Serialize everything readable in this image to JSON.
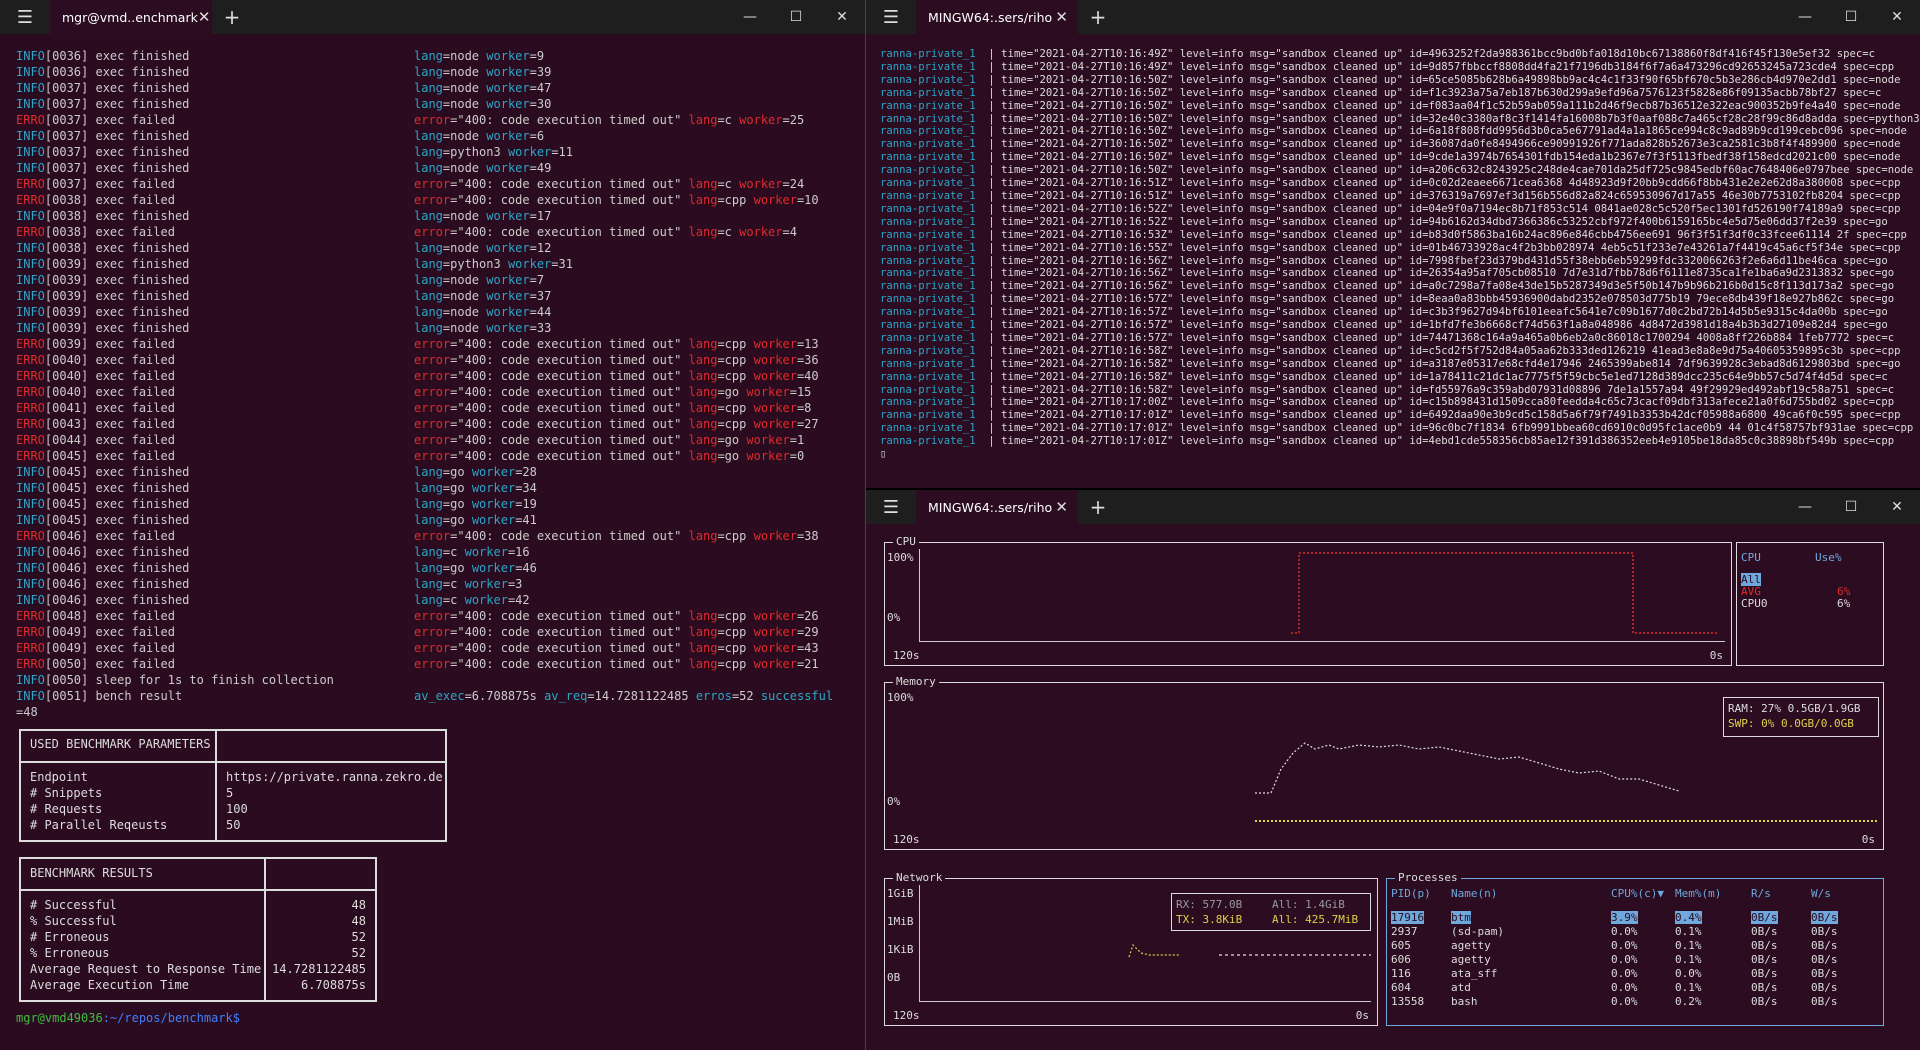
{
  "left": {
    "tab": "mgr@vmd..enchmark",
    "lines": [
      [
        "INFO",
        "[0036] exec finished",
        [
          [
            "lang",
            "node"
          ],
          [
            "worker",
            "9"
          ]
        ]
      ],
      [
        "INFO",
        "[0036] exec finished",
        [
          [
            "lang",
            "node"
          ],
          [
            "worker",
            "39"
          ]
        ]
      ],
      [
        "INFO",
        "[0037] exec finished",
        [
          [
            "lang",
            "node"
          ],
          [
            "worker",
            "47"
          ]
        ]
      ],
      [
        "INFO",
        "[0037] exec finished",
        [
          [
            "lang",
            "node"
          ],
          [
            "worker",
            "30"
          ]
        ]
      ],
      [
        "ERRO",
        "[0037] exec failed",
        [
          [
            "error",
            "\"400: code execution timed out\""
          ],
          [
            "lang",
            "c"
          ],
          [
            "worker",
            "25"
          ]
        ]
      ],
      [
        "INFO",
        "[0037] exec finished",
        [
          [
            "lang",
            "node"
          ],
          [
            "worker",
            "6"
          ]
        ]
      ],
      [
        "INFO",
        "[0037] exec finished",
        [
          [
            "lang",
            "python3"
          ],
          [
            "worker",
            "11"
          ]
        ]
      ],
      [
        "INFO",
        "[0037] exec finished",
        [
          [
            "lang",
            "node"
          ],
          [
            "worker",
            "49"
          ]
        ]
      ],
      [
        "ERRO",
        "[0037] exec failed",
        [
          [
            "error",
            "\"400: code execution timed out\""
          ],
          [
            "lang",
            "c"
          ],
          [
            "worker",
            "24"
          ]
        ]
      ],
      [
        "ERRO",
        "[0038] exec failed",
        [
          [
            "error",
            "\"400: code execution timed out\""
          ],
          [
            "lang",
            "cpp"
          ],
          [
            "worker",
            "10"
          ]
        ]
      ],
      [
        "INFO",
        "[0038] exec finished",
        [
          [
            "lang",
            "node"
          ],
          [
            "worker",
            "17"
          ]
        ]
      ],
      [
        "ERRO",
        "[0038] exec failed",
        [
          [
            "error",
            "\"400: code execution timed out\""
          ],
          [
            "lang",
            "c"
          ],
          [
            "worker",
            "4"
          ]
        ]
      ],
      [
        "INFO",
        "[0038] exec finished",
        [
          [
            "lang",
            "node"
          ],
          [
            "worker",
            "12"
          ]
        ]
      ],
      [
        "INFO",
        "[0039] exec finished",
        [
          [
            "lang",
            "python3"
          ],
          [
            "worker",
            "31"
          ]
        ]
      ],
      [
        "INFO",
        "[0039] exec finished",
        [
          [
            "lang",
            "node"
          ],
          [
            "worker",
            "7"
          ]
        ]
      ],
      [
        "INFO",
        "[0039] exec finished",
        [
          [
            "lang",
            "node"
          ],
          [
            "worker",
            "37"
          ]
        ]
      ],
      [
        "INFO",
        "[0039] exec finished",
        [
          [
            "lang",
            "node"
          ],
          [
            "worker",
            "44"
          ]
        ]
      ],
      [
        "INFO",
        "[0039] exec finished",
        [
          [
            "lang",
            "node"
          ],
          [
            "worker",
            "33"
          ]
        ]
      ],
      [
        "ERRO",
        "[0039] exec failed",
        [
          [
            "error",
            "\"400: code execution timed out\""
          ],
          [
            "lang",
            "cpp"
          ],
          [
            "worker",
            "13"
          ]
        ]
      ],
      [
        "ERRO",
        "[0040] exec failed",
        [
          [
            "error",
            "\"400: code execution timed out\""
          ],
          [
            "lang",
            "cpp"
          ],
          [
            "worker",
            "36"
          ]
        ]
      ],
      [
        "ERRO",
        "[0040] exec failed",
        [
          [
            "error",
            "\"400: code execution timed out\""
          ],
          [
            "lang",
            "cpp"
          ],
          [
            "worker",
            "40"
          ]
        ]
      ],
      [
        "ERRO",
        "[0040] exec failed",
        [
          [
            "error",
            "\"400: code execution timed out\""
          ],
          [
            "lang",
            "go"
          ],
          [
            "worker",
            "15"
          ]
        ]
      ],
      [
        "ERRO",
        "[0041] exec failed",
        [
          [
            "error",
            "\"400: code execution timed out\""
          ],
          [
            "lang",
            "cpp"
          ],
          [
            "worker",
            "8"
          ]
        ]
      ],
      [
        "ERRO",
        "[0043] exec failed",
        [
          [
            "error",
            "\"400: code execution timed out\""
          ],
          [
            "lang",
            "cpp"
          ],
          [
            "worker",
            "27"
          ]
        ]
      ],
      [
        "ERRO",
        "[0044] exec failed",
        [
          [
            "error",
            "\"400: code execution timed out\""
          ],
          [
            "lang",
            "go"
          ],
          [
            "worker",
            "1"
          ]
        ]
      ],
      [
        "ERRO",
        "[0045] exec failed",
        [
          [
            "error",
            "\"400: code execution timed out\""
          ],
          [
            "lang",
            "go"
          ],
          [
            "worker",
            "0"
          ]
        ]
      ],
      [
        "INFO",
        "[0045] exec finished",
        [
          [
            "lang",
            "go"
          ],
          [
            "worker",
            "28"
          ]
        ]
      ],
      [
        "INFO",
        "[0045] exec finished",
        [
          [
            "lang",
            "go"
          ],
          [
            "worker",
            "34"
          ]
        ]
      ],
      [
        "INFO",
        "[0045] exec finished",
        [
          [
            "lang",
            "go"
          ],
          [
            "worker",
            "19"
          ]
        ]
      ],
      [
        "INFO",
        "[0045] exec finished",
        [
          [
            "lang",
            "go"
          ],
          [
            "worker",
            "41"
          ]
        ]
      ],
      [
        "ERRO",
        "[0046] exec failed",
        [
          [
            "error",
            "\"400: code execution timed out\""
          ],
          [
            "lang",
            "cpp"
          ],
          [
            "worker",
            "38"
          ]
        ]
      ],
      [
        "INFO",
        "[0046] exec finished",
        [
          [
            "lang",
            "c"
          ],
          [
            "worker",
            "16"
          ]
        ]
      ],
      [
        "INFO",
        "[0046] exec finished",
        [
          [
            "lang",
            "go"
          ],
          [
            "worker",
            "46"
          ]
        ]
      ],
      [
        "INFO",
        "[0046] exec finished",
        [
          [
            "lang",
            "c"
          ],
          [
            "worker",
            "3"
          ]
        ]
      ],
      [
        "INFO",
        "[0046] exec finished",
        [
          [
            "lang",
            "c"
          ],
          [
            "worker",
            "42"
          ]
        ]
      ],
      [
        "ERRO",
        "[0048] exec failed",
        [
          [
            "error",
            "\"400: code execution timed out\""
          ],
          [
            "lang",
            "cpp"
          ],
          [
            "worker",
            "26"
          ]
        ]
      ],
      [
        "ERRO",
        "[0049] exec failed",
        [
          [
            "error",
            "\"400: code execution timed out\""
          ],
          [
            "lang",
            "cpp"
          ],
          [
            "worker",
            "29"
          ]
        ]
      ],
      [
        "ERRO",
        "[0049] exec failed",
        [
          [
            "error",
            "\"400: code execution timed out\""
          ],
          [
            "lang",
            "cpp"
          ],
          [
            "worker",
            "43"
          ]
        ]
      ],
      [
        "ERRO",
        "[0050] exec failed",
        [
          [
            "error",
            "\"400: code execution timed out\""
          ],
          [
            "lang",
            "cpp"
          ],
          [
            "worker",
            "21"
          ]
        ]
      ],
      [
        "INFO",
        "[0050] sleep for 1s to finish collection",
        []
      ],
      [
        "INFO",
        "[0051] bench result",
        [
          [
            "av_exec",
            "6.708875s"
          ],
          [
            "av_req",
            "14.7281122485"
          ],
          [
            "erros",
            "52"
          ],
          [
            "successful",
            ""
          ]
        ]
      ]
    ],
    "wrap": "=48",
    "params_title": "USED BENCHMARK PARAMETERS",
    "params": [
      [
        "Endpoint",
        "https://private.ranna.zekro.de"
      ],
      [
        "# Snippets",
        "5"
      ],
      [
        "# Requests",
        "100"
      ],
      [
        "# Parallel Reqeusts",
        "50"
      ]
    ],
    "results_title": "BENCHMARK RESULTS",
    "results": [
      [
        "# Successful",
        "48"
      ],
      [
        "% Successful",
        "48"
      ],
      [
        "# Erroneous",
        "52"
      ],
      [
        "% Erroneous",
        "52"
      ],
      [
        "Average Request to Response Time",
        "14.7281122485"
      ],
      [
        "Average Execution Time",
        "6.708875s"
      ]
    ],
    "prompt_user": "mgr@vmd49036",
    "prompt_path": ":~/repos/benchmark$"
  },
  "tr": {
    "tab": "MINGW64:.sers/riho",
    "svc": "ranna-private_1",
    "logs": [
      [
        "16:49Z",
        "4963252f2da988361bcc9bd0bfa018d10bc67138860f8df416f45f130e5ef32",
        "c"
      ],
      [
        "16:49Z",
        "9d857fbbccf8808dd4fa21f7196db3184f6f7a6a473296cd92653245a723cde4",
        "cpp"
      ],
      [
        "16:50Z",
        "65ce5085b628b6a49898bb9ac4c4c1f33f90f65bf670c5b3e286cb4d970e2dd1",
        "node"
      ],
      [
        "16:50Z",
        "f1c3923a75a7eb187b630d299a9efd96a7576123f5828e86f09135acbb78bf27",
        "c"
      ],
      [
        "16:50Z",
        "f083aa04f1c52b59ab059a111b2d46f9ecb87b36512e322eac900352b9fe4a40",
        "node"
      ],
      [
        "16:50Z",
        "32e40c3380af8c3f1414fa16008b7b3f0aaf088c7a465cf28c28f99c86d8adda",
        "python3"
      ],
      [
        "16:50Z",
        "6a18f808fdd9956d3b0ca5e67791ad4a1a1865ce994c8c9ad89b9cd199cebc096",
        "node"
      ],
      [
        "16:50Z",
        "36087da0fe8494966ce90991926f771ada828b52673e3ca2581c3b8f4f489900",
        "node"
      ],
      [
        "16:50Z",
        "9cde1a3974b7654301fdb154eda1b2367e7f3f5113fbedf38f158edcd2021c00",
        "node"
      ],
      [
        "16:50Z",
        "a206c632c8243925c248de4cae701da25df725c9845edbf60ac7648406e0797bee",
        "node"
      ],
      [
        "16:51Z",
        "0c02d2eaee6671cea6368 4d48923d9f20bb9cdd66f8bb431e2e2e62d8a380008",
        "cpp"
      ],
      [
        "16:51Z",
        "376319a7697ef3d156b556d82a824c659530967d17a55 46e30b7753102fb8204",
        "cpp"
      ],
      [
        "16:52Z",
        "04e9f0a7194ec8b71f853c514 0841ae028c5c520f5ec1301fd526190f74189a9",
        "cpp"
      ],
      [
        "16:52Z",
        "94b6162d34dbd7366386c53252cbf972f400b6159165bc4e5d75e06dd37f2e39",
        "go"
      ],
      [
        "16:53Z",
        "b83d0f5863ba16b24ac896e846cbb4756ee691 96f3f51f3df0c33fcee61114 2f",
        "cpp"
      ],
      [
        "16:55Z",
        "01b46733928ac4f2b3bb028974 4eb5c51f233e7e43261a7f4419c45a6cf5f34e",
        "cpp"
      ],
      [
        "16:56Z",
        "7998fbef23d379bd431d55f38ebb6eb59299fdc3320066263f2e6a6d11be46ca",
        "go"
      ],
      [
        "16:56Z",
        "26354a95af705cb08510 7d7e31d7fbb78d6f6111e8735ca1fe1ba6a9d2313832",
        "go"
      ],
      [
        "16:56Z",
        "a0c7298a7fa08e43de15b5287349d3e5f50b147b9b96b216b0d15c8f113d173a2",
        "go"
      ],
      [
        "16:57Z",
        "8eaa0a83bbb45936900dabd2352e078503d775b19 79ece8db439f18e927b862c",
        "go"
      ],
      [
        "16:57Z",
        "c3b3f9627d94bf6101eeafc5641e7c09b1677d0c2bd72b14d5b5e9315c4da00b",
        "go"
      ],
      [
        "16:57Z",
        "1bfd7fe3b6668cf74d563f1a8a048986 4d8472d3981d18a4b3b3d27109e82d4",
        "go"
      ],
      [
        "16:57Z",
        "74471368c164a9a465a0b6eb2a0c86018c1700294 4008a8ff226b884 1feb7772",
        "c"
      ],
      [
        "16:58Z",
        "c5cd2f5f752d84a05aa62b333ded126219 41ead3e8a8e9d75a40605359895c3b",
        "cpp"
      ],
      [
        "16:58Z",
        "a3187e05317e68cfd4e17946 2465399abe814 7df9639928c3ebad8d6129803bd",
        "go"
      ],
      [
        "16:58Z",
        "1a78411c21dc1ac7775f5f59cbc5e1ed7128d389dcc235c64e9bb57c5d74f4d5d",
        "c"
      ],
      [
        "16:58Z",
        "fd55976a9c359abd07931d08896 7de1a1557a94 49f29929ed492abf19c58a751",
        "c"
      ],
      [
        "17:00Z",
        "c15b898431d1509cca80feedda4c65c73cacf09dbf313afece21a0f6d755bd02",
        "cpp"
      ],
      [
        "17:01Z",
        "6492daa90e3b9cd5c158d5a6f79f7491b3353b42dcf05988a6800 49ca6f0c595",
        "cpp"
      ],
      [
        "17:01Z",
        "96c0bc7f1834 6fb9991bbea60cd6910c0d95fc1ace0b9 44 01c4f58757bf931ae",
        "cpp"
      ],
      [
        "17:01Z",
        "4ebd1cde558356cb85ae12f391d386352eeb4e9105be18da85c0c38898bf549b",
        "cpp"
      ]
    ]
  },
  "br": {
    "tab": "MINGW64:.sers/riho",
    "cpu_title": "CPU",
    "cpu_hdr": [
      "CPU",
      "Use%"
    ],
    "cpu_rows": [
      [
        "All",
        ""
      ],
      [
        "AVG",
        "6%"
      ],
      [
        "CPU0",
        "6%"
      ]
    ],
    "pct100": "100%",
    "pct0": "0%",
    "t120": "120s",
    "t0": "0s",
    "mem_title": "Memory",
    "ram": "RAM: 27%   0.5GB/1.9GB",
    "swp": "SWP:  0%   0.0GB/0.0GB",
    "net_title": "Network",
    "net_axis": [
      "1GiB",
      "1MiB",
      "1KiB",
      "0B"
    ],
    "rx": "RX: 577.0B",
    "rxall": "All: 1.4GiB",
    "tx": "TX: 3.8KiB",
    "txall": "All: 425.7MiB",
    "proc_title": "Processes",
    "proc_hdr": [
      "PID(p)",
      "Name(n)",
      "CPU%(c)▼",
      "Mem%(m)",
      "R/s",
      "W/s"
    ],
    "procs": [
      [
        "17916",
        "btm",
        "3.9%",
        "0.4%",
        "0B/s",
        "0B/s"
      ],
      [
        "2937",
        "(sd-pam)",
        "0.0%",
        "0.1%",
        "0B/s",
        "0B/s"
      ],
      [
        "605",
        "agetty",
        "0.0%",
        "0.1%",
        "0B/s",
        "0B/s"
      ],
      [
        "606",
        "agetty",
        "0.0%",
        "0.1%",
        "0B/s",
        "0B/s"
      ],
      [
        "116",
        "ata_sff",
        "0.0%",
        "0.0%",
        "0B/s",
        "0B/s"
      ],
      [
        "604",
        "atd",
        "0.0%",
        "0.1%",
        "0B/s",
        "0B/s"
      ],
      [
        "13558",
        "bash",
        "0.0%",
        "0.2%",
        "0B/s",
        "0B/s"
      ]
    ]
  }
}
